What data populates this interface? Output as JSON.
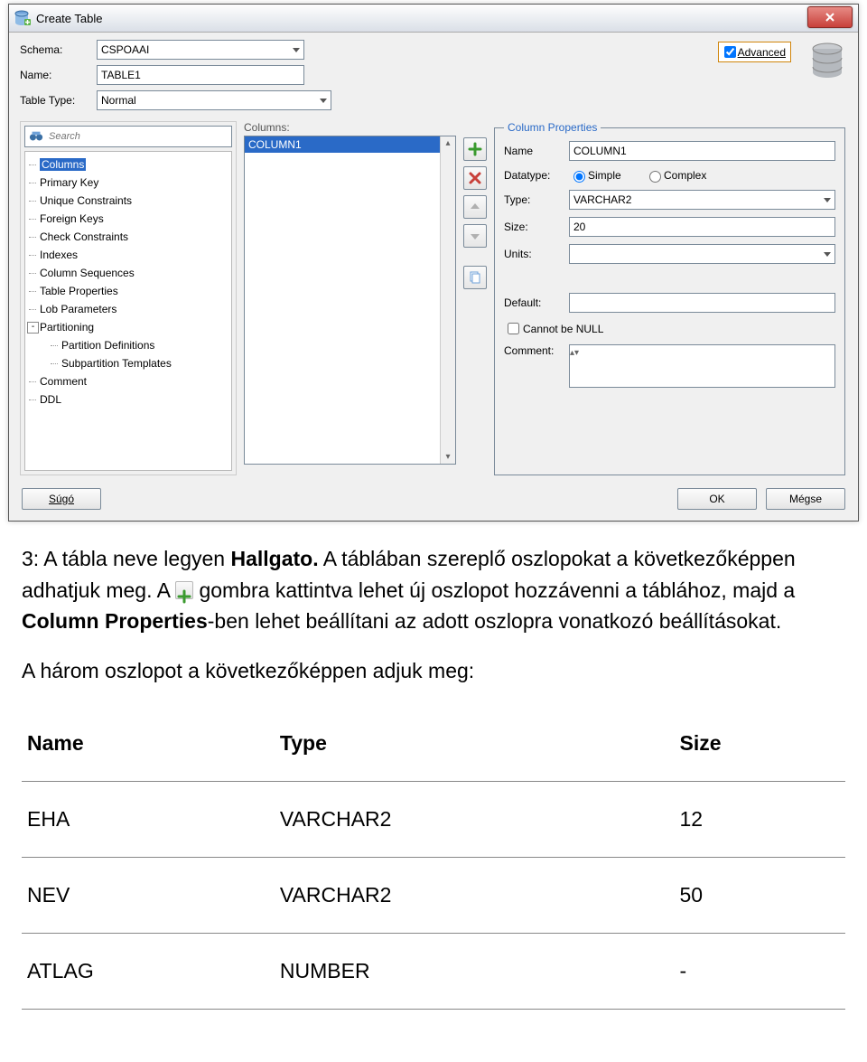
{
  "dialog": {
    "title": "Create Table",
    "schema_label": "Schema:",
    "schema_value": "CSPOAAI",
    "name_label": "Name:",
    "name_value": "TABLE1",
    "tabletype_label": "Table Type:",
    "tabletype_value": "Normal",
    "advanced_label": "Advanced",
    "search_placeholder": "Search",
    "tree_items": [
      "Columns",
      "Primary Key",
      "Unique Constraints",
      "Foreign Keys",
      "Check Constraints",
      "Indexes",
      "Column Sequences",
      "Table Properties",
      "Lob Parameters",
      "Partitioning",
      "Partition Definitions",
      "Subpartition Templates",
      "Comment",
      "DDL"
    ],
    "columns_label": "Columns:",
    "columns_list_selected": "COLUMN1",
    "props": {
      "legend": "Column Properties",
      "name_label": "Name",
      "name_value": "COLUMN1",
      "datatype_label": "Datatype:",
      "datatype_simple": "Simple",
      "datatype_complex": "Complex",
      "type_label": "Type:",
      "type_value": "VARCHAR2",
      "size_label": "Size:",
      "size_value": "20",
      "units_label": "Units:",
      "units_value": "",
      "default_label": "Default:",
      "default_value": "",
      "notnull_label": "Cannot be NULL",
      "comment_label": "Comment:"
    },
    "buttons": {
      "help": "Súgó",
      "ok": "OK",
      "cancel": "Mégse"
    }
  },
  "doc": {
    "p1a": "3: A tábla neve legyen ",
    "p1_bold": "Hallgato.",
    "p1b": " A táblában szereplő oszlopokat a következőképpen adhatjuk meg. A ",
    "p1c": " gombra kattintva lehet új oszlopot hozzávenni a táblához, majd a ",
    "p1_bold2": "Column Properties",
    "p1d": "-ben lehet beállítani az adott oszlopra vonatkozó beállításokat.",
    "p2": "A három oszlopot a következőképpen adjuk meg:"
  },
  "table": {
    "headers": [
      "Name",
      "Type",
      "Size"
    ],
    "rows": [
      [
        "EHA",
        "VARCHAR2",
        "12"
      ],
      [
        "NEV",
        "VARCHAR2",
        "50"
      ],
      [
        "ATLAG",
        "NUMBER",
        "-"
      ]
    ]
  }
}
